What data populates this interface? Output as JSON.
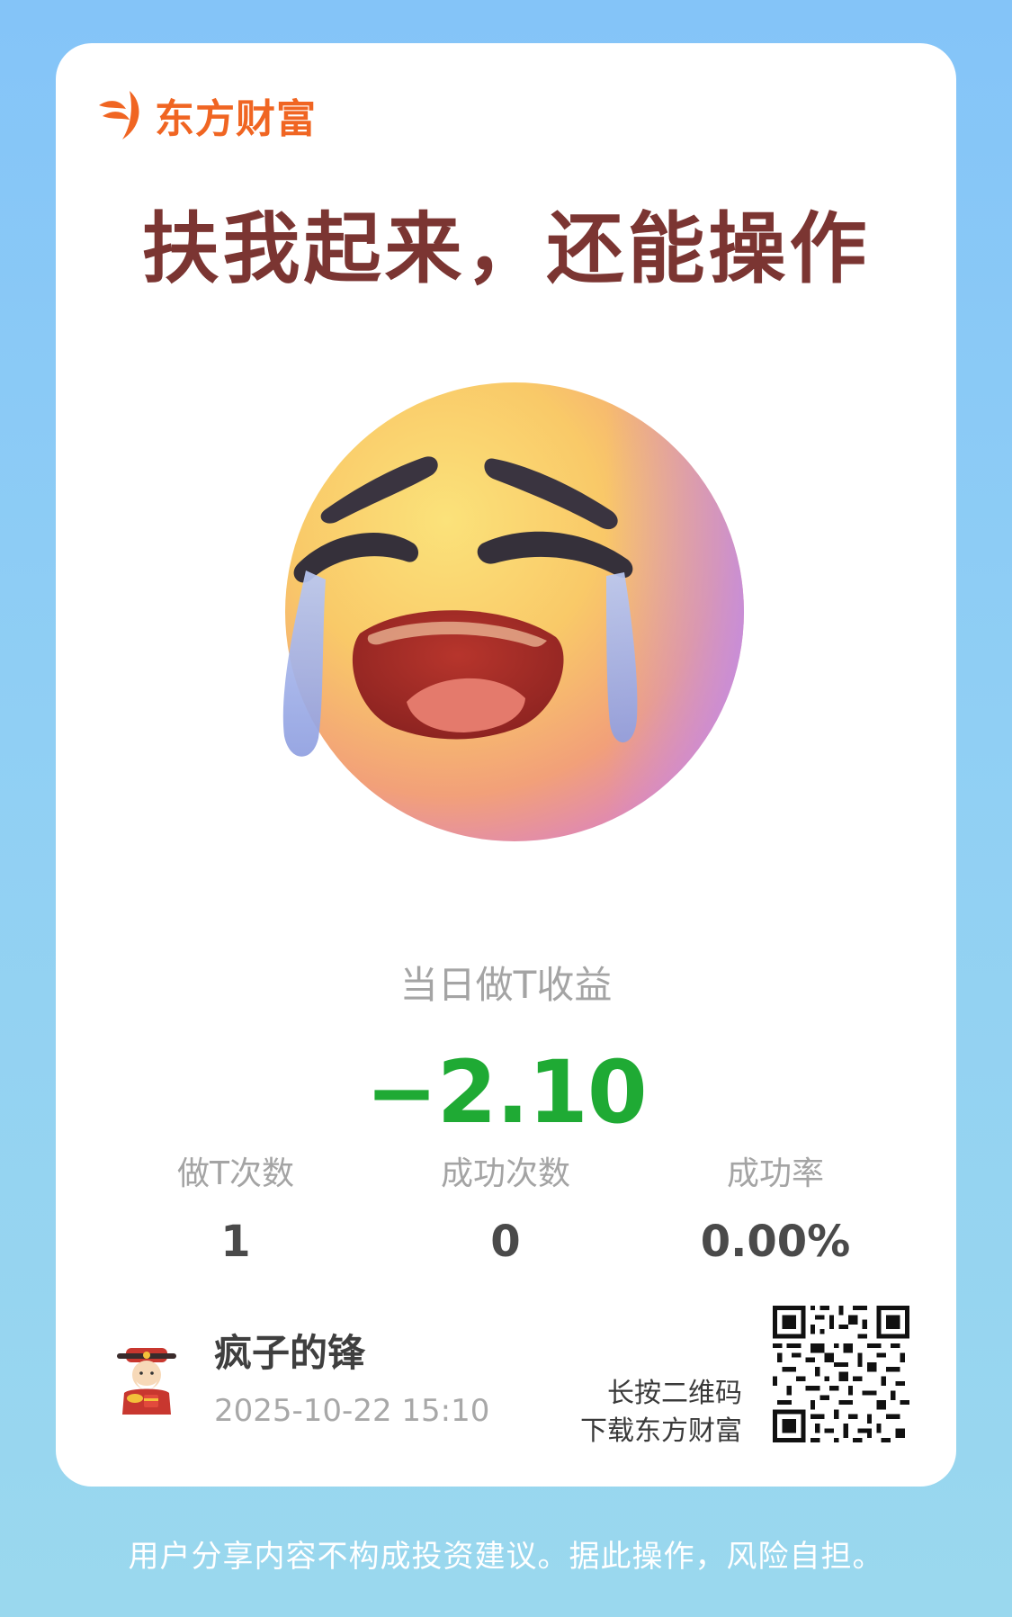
{
  "brand": {
    "name": "东方财富",
    "color": "#f06522"
  },
  "headline": "扶我起来，还能操作",
  "emoji": "loudly-crying-face",
  "income": {
    "label": "当日做T收益",
    "value": "−2.10",
    "color": "#1faa34"
  },
  "stats": [
    {
      "label": "做T次数",
      "value": "1"
    },
    {
      "label": "成功次数",
      "value": "0"
    },
    {
      "label": "成功率",
      "value": "0.00%"
    }
  ],
  "user": {
    "name": "疯子的锋",
    "timestamp": "2025-10-22 15:10",
    "avatar": "god-of-wealth-avatar"
  },
  "qr": {
    "line1": "长按二维码",
    "line2": "下载东方财富"
  },
  "disclaimer": "用户分享内容不构成投资建议。据此操作，风险自担。"
}
